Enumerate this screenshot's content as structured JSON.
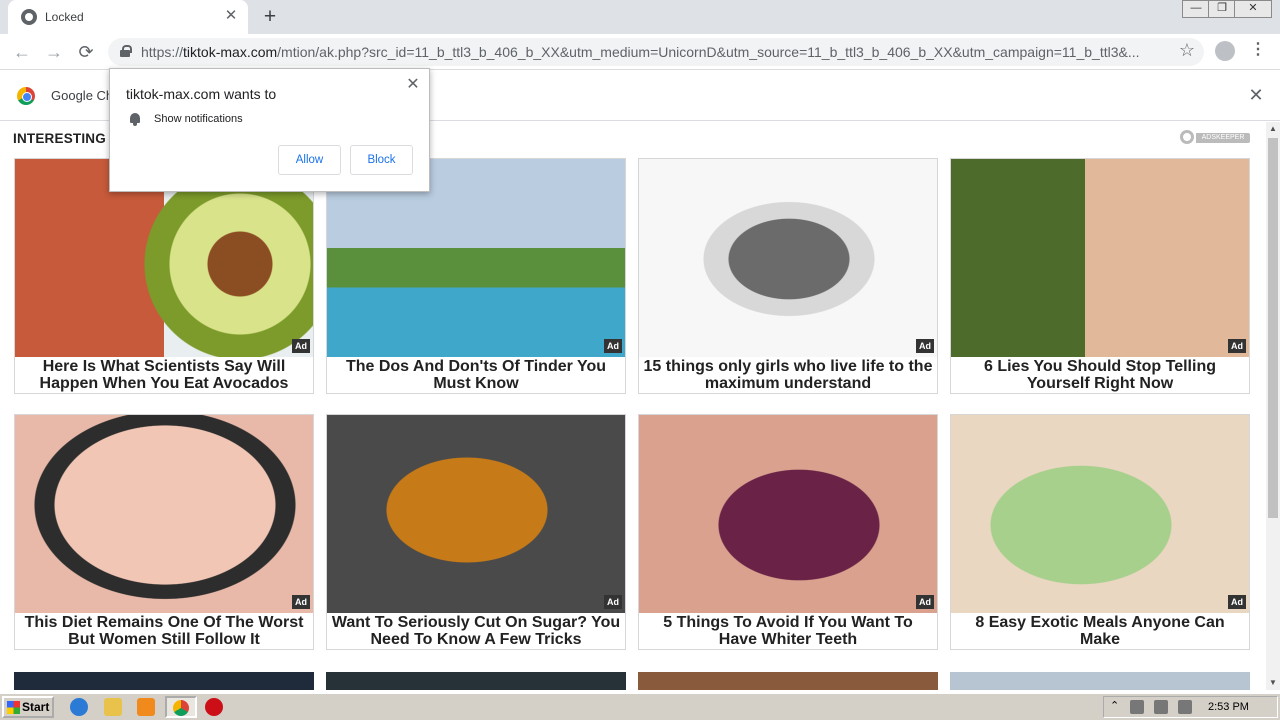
{
  "tab": {
    "title": "Locked",
    "close_label": "✕",
    "new_tab_label": "+"
  },
  "window": {
    "minimize": "—",
    "maximize": "❐",
    "close": "✕"
  },
  "toolbar": {
    "back": "←",
    "forward": "→",
    "reload": "⟳",
    "url_scheme": "https://",
    "url_host": "tiktok-max.com",
    "url_path": "/mtion/ak.php?src_id=11_b_ttl3_b_406_b_XX&utm_medium=UnicornD&utm_source=11_b_ttl3_b_406_b_XX&utm_campaign=11_b_ttl3&...",
    "star": "☆",
    "menu": "⋮"
  },
  "infobar": {
    "text": "Google Ch",
    "close": "✕"
  },
  "popup": {
    "title": "tiktok-max.com wants to",
    "permission": "Show notifications",
    "close": "✕",
    "allow": "Allow",
    "block": "Block"
  },
  "page": {
    "section_title": "INTERESTING",
    "adskeeper_label": "ADSKEEPER",
    "ad_badge": "Ad",
    "cards": [
      {
        "title": "Here Is What Scientists Say Will Happen When You Eat Avocados"
      },
      {
        "title": "The Dos And Don'ts Of Tinder You Must Know"
      },
      {
        "title": "15 things only girls who live life to the maximum understand"
      },
      {
        "title": "6 Lies You Should Stop Telling Yourself Right Now"
      },
      {
        "title": "This Diet Remains One Of The Worst But Women Still Follow It"
      },
      {
        "title": "Want To Seriously Cut On Sugar? You Need To Know A Few Tricks"
      },
      {
        "title": "5 Things To Avoid If You Want To Have Whiter Teeth"
      },
      {
        "title": "8 Easy Exotic Meals Anyone Can Make"
      }
    ]
  },
  "scrollbar": {
    "up": "▲",
    "down": "▼"
  },
  "taskbar": {
    "start": "Start",
    "tray_up": "⌃",
    "time": "2:53 PM"
  }
}
